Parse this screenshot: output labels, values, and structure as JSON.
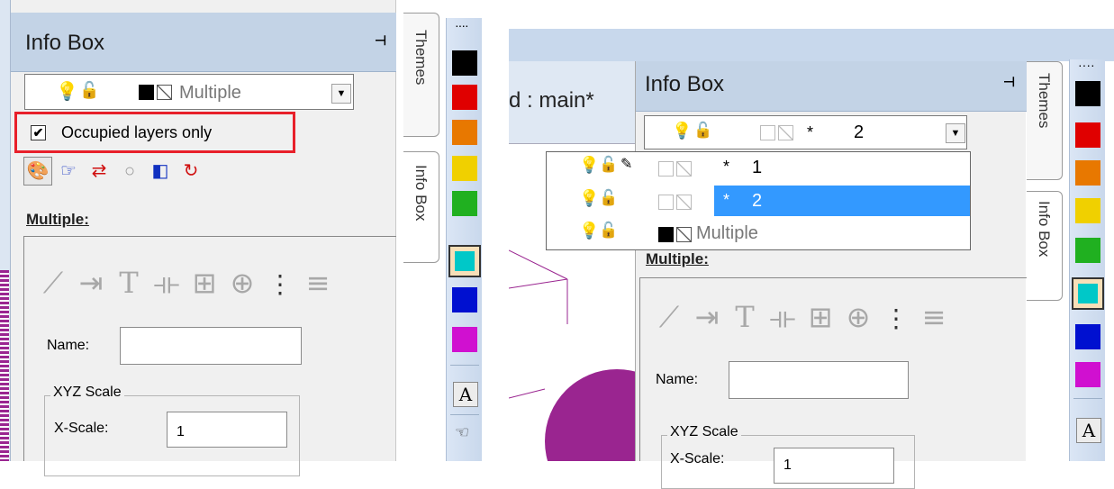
{
  "left": {
    "title": "Info Box",
    "pin_icon": "pin-icon",
    "combo": {
      "selected": "Multiple",
      "icons": [
        "bulb-icon",
        "lock-open-icon",
        "black-swatch",
        "hatch-swatch"
      ]
    },
    "occupied_checkbox": {
      "label": "Occupied layers only",
      "checked": true,
      "highlight_color": "#e8202a"
    },
    "toolbar_icons": [
      "palette-icon",
      "pointer-icon",
      "swap-icon",
      "circle-icon",
      "color-fill-icon",
      "refresh-icon"
    ],
    "section_label": "Multiple:",
    "property_icons": [
      "line-icon",
      "arrow-icon",
      "text-icon",
      "dimension-icon",
      "grid-icon",
      "crosshair-icon",
      "bars-icon",
      "lines-icon"
    ],
    "name_label": "Name:",
    "name_value": "",
    "xyz_group": "XYZ Scale",
    "x_scale_label": "X-Scale:",
    "x_scale_value": "1",
    "side_tabs": [
      "Themes",
      "Info Box"
    ]
  },
  "right": {
    "doc_tab": "d : main*",
    "title": "Info Box",
    "combo": {
      "star": "*",
      "selected": "2"
    },
    "dropdown_items": [
      {
        "star": "*",
        "label": "1",
        "selected": false,
        "pencil": true
      },
      {
        "star": "*",
        "label": "2",
        "selected": true,
        "pencil": false
      },
      {
        "star": "",
        "label": "Multiple",
        "selected": false,
        "pencil": false
      }
    ],
    "section_label": "Multiple:",
    "name_label": "Name:",
    "name_value": "",
    "xyz_group": "XYZ Scale",
    "x_scale_label": "X-Scale:",
    "x_scale_value": "1",
    "side_tabs": [
      "Themes",
      "Info Box"
    ]
  },
  "palette": {
    "colors": [
      "#000000",
      "#e00000",
      "#e87800",
      "#f0d000",
      "#20b020",
      "#00c8c8",
      "#0010d0",
      "#d010d0"
    ],
    "selected_index": 5,
    "text_tool": "A"
  }
}
